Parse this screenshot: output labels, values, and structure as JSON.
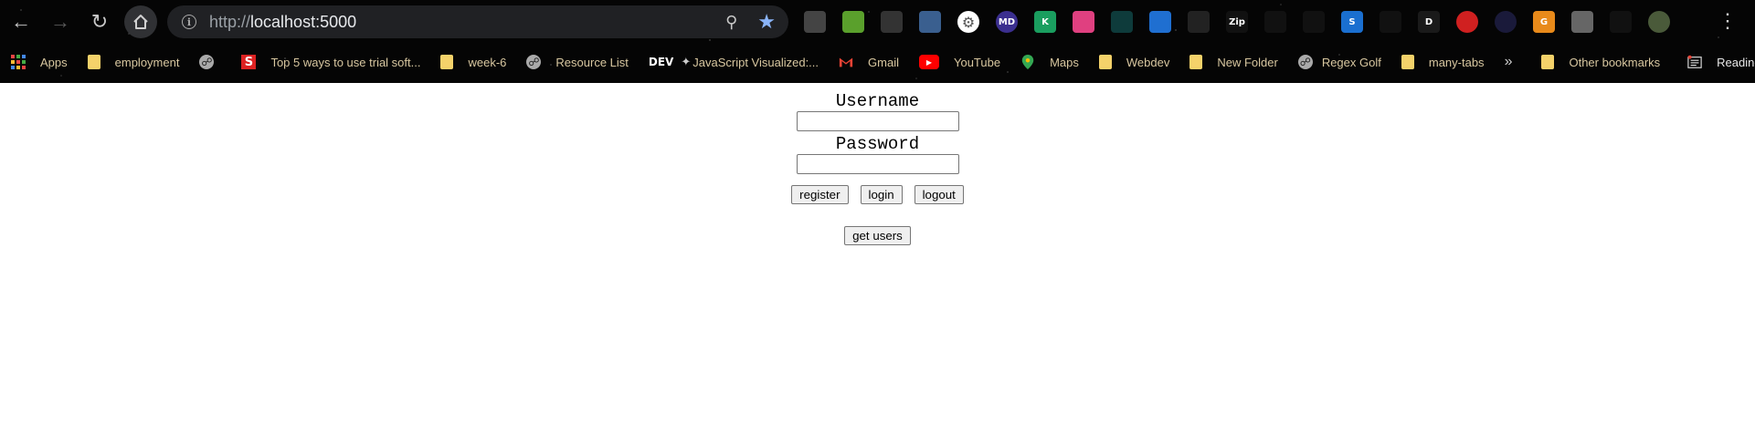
{
  "toolbar": {
    "url_scheme": "http://",
    "url_host": "localhost:5000"
  },
  "bookmarks": [
    {
      "label": "Apps",
      "icon": "apps-grid-icon"
    },
    {
      "label": "employment",
      "icon": "folder-icon"
    },
    {
      "label": "",
      "icon": "globe-icon"
    },
    {
      "label": "Top 5 ways to use trial soft...",
      "icon": "s-logo-icon"
    },
    {
      "label": "week-6",
      "icon": "folder-icon"
    },
    {
      "label": "Resource List",
      "icon": "globe-icon"
    },
    {
      "label": "JavaScript Visualized:...",
      "icon": "dev-logo-icon"
    },
    {
      "label": "Gmail",
      "icon": "gmail-icon"
    },
    {
      "label": "YouTube",
      "icon": "youtube-icon"
    },
    {
      "label": "Maps",
      "icon": "maps-icon"
    },
    {
      "label": "Webdev",
      "icon": "folder-icon"
    },
    {
      "label": "New Folder",
      "icon": "folder-icon"
    },
    {
      "label": "Regex Golf",
      "icon": "globe-icon"
    },
    {
      "label": "many-tabs",
      "icon": "folder-icon"
    }
  ],
  "bookmarks_more": "»",
  "other_bookmarks": "Other bookmarks",
  "reading_list": "Reading list",
  "dev_text": "DEV",
  "extensions": [
    {
      "icon": "camera-icon",
      "color": "#444"
    },
    {
      "icon": "color-picker-icon",
      "color": "#5aa02c"
    },
    {
      "icon": "cube-icon",
      "color": "#333"
    },
    {
      "icon": "image-icon",
      "color": "#3a5f8f"
    },
    {
      "icon": "gear-badge-icon",
      "color": "#ffffff"
    },
    {
      "icon": "md-icon",
      "color": "#3b2f8f",
      "text": "MD"
    },
    {
      "icon": "k-icon",
      "color": "#1a9e5f",
      "text": "K"
    },
    {
      "icon": "color-wheel-icon",
      "color": "#e04080"
    },
    {
      "icon": "code-check-icon",
      "color": "#0e3b3b"
    },
    {
      "icon": "briefcase-icon",
      "color": "#1f6fd1"
    },
    {
      "icon": "s-hook-icon",
      "color": "#222"
    },
    {
      "icon": "gzip-icon",
      "color": "#111",
      "text": "Zip"
    },
    {
      "icon": "react-icon",
      "color": "#111"
    },
    {
      "icon": "clock-icon",
      "color": "#111"
    },
    {
      "icon": "s-square-icon",
      "color": "#1a6fd0",
      "text": "S"
    },
    {
      "icon": "target-icon",
      "color": "#111"
    },
    {
      "icon": "d-icon",
      "color": "#1a1a1a",
      "text": "D"
    },
    {
      "icon": "pokeball-icon",
      "color": "#d02020"
    },
    {
      "icon": "moon-icon",
      "color": "#1a1a3a"
    },
    {
      "icon": "g-icon",
      "color": "#e88a1a",
      "text": "G"
    },
    {
      "icon": "tab-manager-icon",
      "color": "#666"
    },
    {
      "icon": "puzzle-icon",
      "color": "#111"
    },
    {
      "icon": "profile-avatar-icon",
      "color": "#4a5a3a"
    }
  ],
  "form": {
    "username_label": "Username",
    "username_value": "",
    "password_label": "Password",
    "password_value": "",
    "register_label": "register",
    "login_label": "login",
    "logout_label": "logout",
    "get_users_label": "get users"
  }
}
